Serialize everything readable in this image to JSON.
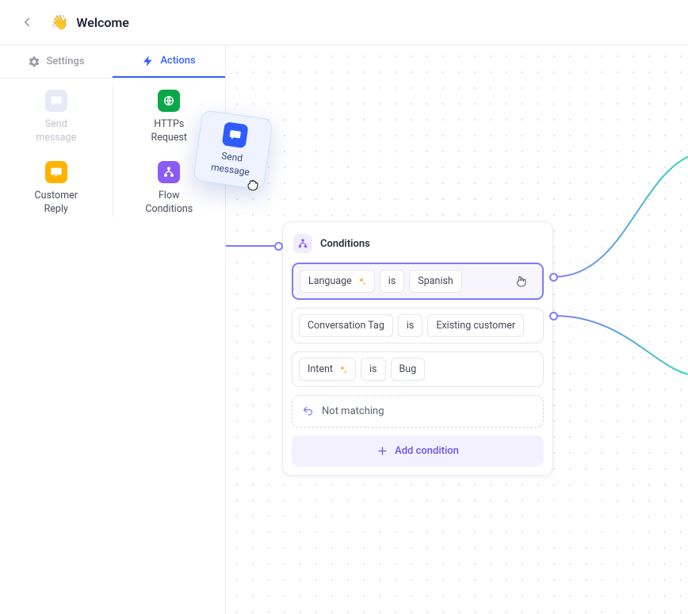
{
  "header": {
    "back_aria": "Back",
    "emoji": "👋",
    "title": "Welcome"
  },
  "tabs": {
    "settings": "Settings",
    "actions": "Actions"
  },
  "palette": {
    "send_message": "Send\nmessage",
    "customer_reply": "Customer\nReply",
    "https_request": "HTTPs\nRequest",
    "flow_conditions": "Flow\nConditions"
  },
  "drag": {
    "label": "Send\nmessage"
  },
  "node": {
    "title": "Conditions",
    "rows": [
      {
        "field": "Language",
        "op": "is",
        "value": "Spanish",
        "ai": true
      },
      {
        "field": "Conversation Tag",
        "op": "is",
        "value": "Existing customer",
        "ai": false
      },
      {
        "field": "Intent",
        "op": "is",
        "value": "Bug",
        "ai": true
      }
    ],
    "not_matching": "Not matching",
    "add_condition": "Add condition"
  },
  "colors": {
    "accent": "#7e7bff",
    "link_blue": "#3860ff"
  }
}
